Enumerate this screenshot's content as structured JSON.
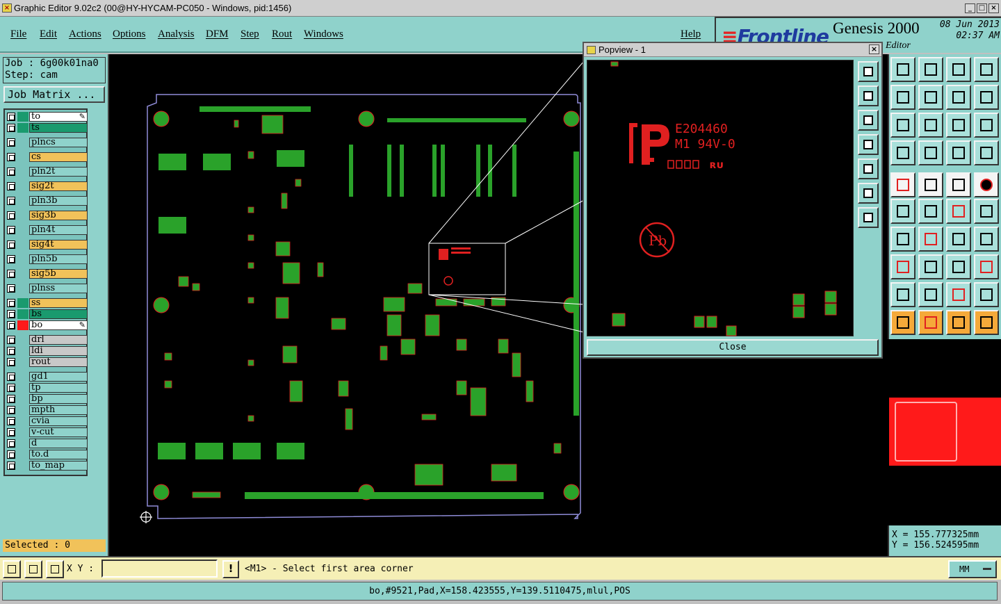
{
  "window": {
    "title": "Graphic Editor 9.02c2 (00@HY-HYCAM-PC050 - Windows, pid:1456)"
  },
  "menu": {
    "items": [
      "File",
      "Edit",
      "Actions",
      "Options",
      "Analysis",
      "DFM",
      "Step",
      "Rout",
      "Windows"
    ],
    "help": "Help"
  },
  "brand": {
    "logo": "Frontline",
    "product": "Genesis 2000",
    "subtitle": "Editor",
    "date": "08 Jun 2013",
    "time": "02:37 AM"
  },
  "job": {
    "job_line": "Job : 6g00k01na0",
    "step_line": "Step: cam",
    "matrix_label": "Job Matrix ..."
  },
  "layers": [
    {
      "name": "to",
      "color": "#ffffff",
      "swatch": "#1a9a6e",
      "tag": "edit"
    },
    {
      "name": "ts",
      "color": "#1a9a6e",
      "swatch": "#1a9a6e"
    },
    {
      "name": "plncs",
      "color": "#8fd2cb",
      "swatch": ""
    },
    {
      "name": "cs",
      "color": "#f1c25a",
      "swatch": ""
    },
    {
      "name": "pln2t",
      "color": "#8fd2cb",
      "swatch": ""
    },
    {
      "name": "sig2t",
      "color": "#f1c25a",
      "swatch": ""
    },
    {
      "name": "pln3b",
      "color": "#8fd2cb",
      "swatch": ""
    },
    {
      "name": "sig3b",
      "color": "#f1c25a",
      "swatch": ""
    },
    {
      "name": "pln4t",
      "color": "#8fd2cb",
      "swatch": ""
    },
    {
      "name": "sig4t",
      "color": "#f1c25a",
      "swatch": ""
    },
    {
      "name": "pln5b",
      "color": "#8fd2cb",
      "swatch": ""
    },
    {
      "name": "sig5b",
      "color": "#f1c25a",
      "swatch": ""
    },
    {
      "name": "plnss",
      "color": "#8fd2cb",
      "swatch": ""
    },
    {
      "name": "ss",
      "color": "#f1c25a",
      "swatch": "#1a9a6e"
    },
    {
      "name": "bs",
      "color": "#1a9a6e",
      "swatch": "#1a9a6e"
    },
    {
      "name": "bo",
      "color": "#ffffff",
      "swatch": "#ff1a1a",
      "tag": "edit"
    },
    {
      "name": "drl",
      "color": "#c8c8c8",
      "swatch": ""
    },
    {
      "name": "ldi",
      "color": "#c8c8c8",
      "swatch": ""
    },
    {
      "name": "rout",
      "color": "#c8c8c8",
      "swatch": ""
    },
    {
      "name": "gd1",
      "color": "#8fd2cb",
      "swatch": ""
    },
    {
      "name": "tp",
      "color": "#8fd2cb",
      "swatch": ""
    },
    {
      "name": "bp",
      "color": "#8fd2cb",
      "swatch": ""
    },
    {
      "name": "mpth",
      "color": "#8fd2cb",
      "swatch": ""
    },
    {
      "name": "cvia",
      "color": "#8fd2cb",
      "swatch": ""
    },
    {
      "name": "v-cut",
      "color": "#8fd2cb",
      "swatch": ""
    },
    {
      "name": "d",
      "color": "#8fd2cb",
      "swatch": ""
    },
    {
      "name": "to.d",
      "color": "#8fd2cb",
      "swatch": ""
    },
    {
      "name": "to_map",
      "color": "#8fd2cb",
      "swatch": ""
    }
  ],
  "selected": "Selected : 0",
  "popview": {
    "title": "Popview - 1",
    "close_label": "Close",
    "marking_line1": "E204460",
    "marking_line2": "M1 94V-0",
    "marking_pb": "Pb"
  },
  "coords": {
    "x": "X =  155.777325mm",
    "y": "Y =  156.524595mm"
  },
  "bottom": {
    "xy_label": "X Y :",
    "xy_value": "",
    "prompt": "<M1> - Select first area corner",
    "units": "MM"
  },
  "status": "bo,#9521,Pad,X=158.423555,Y=139.5110475,mlul,POS",
  "colors": {
    "teal": "#8fd2cb",
    "pad_green": "#2aa22a",
    "bo_red": "#ff1a1a",
    "orange": "#f1c25a"
  }
}
